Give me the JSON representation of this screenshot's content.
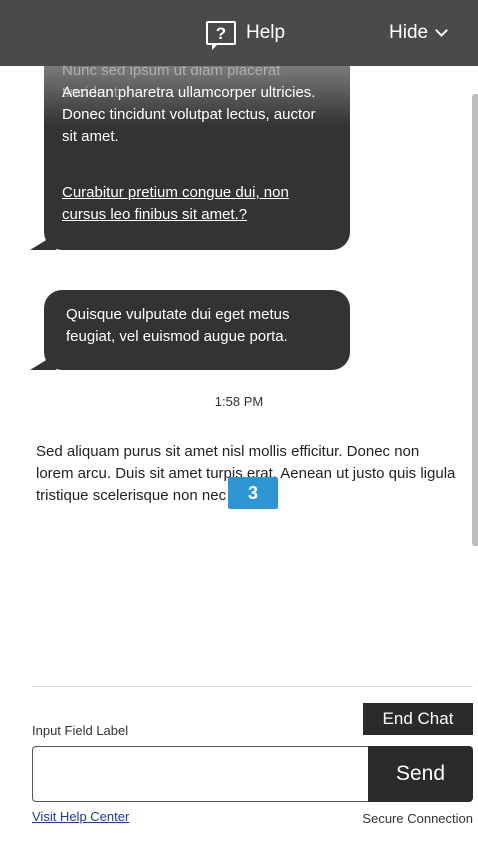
{
  "header": {
    "help_icon_glyph": "?",
    "help_label": "Help",
    "hide_label": "Hide",
    "background": "#4a4a4a"
  },
  "messages": {
    "bubble1_partial": "Nunc sed ipsum ut diam placerat tincidunt.",
    "bubble1_text": "Aenean pharetra ullamcorper ultricies. Donec tincidunt volutpat lectus, auctor sit amet.",
    "bubble1_link": "Curabitur pretium congue dui, non cursus leo finibus sit amet.?",
    "bubble2_text": "Quisque vulputate dui eget metus feugiat, vel euismod augue porta.",
    "timestamp": "1:58 PM",
    "agent_text": "Sed aliquam purus sit amet nisl mollis efficitur. Donec non lorem arcu. Duis sit amet turpis erat. Aenean ut justo quis ligula tristique scelerisque non nec dolor."
  },
  "badge": {
    "number": "3",
    "color": "#2f96d4"
  },
  "composer": {
    "input_label": "Input Field Label",
    "end_chat_label": "End Chat",
    "input_value": "",
    "send_label": "Send",
    "help_center_link": "Visit Help Center",
    "secure_text": "Secure Connection"
  },
  "colors": {
    "bubble": "#333333",
    "link": "#1a3aa8"
  }
}
